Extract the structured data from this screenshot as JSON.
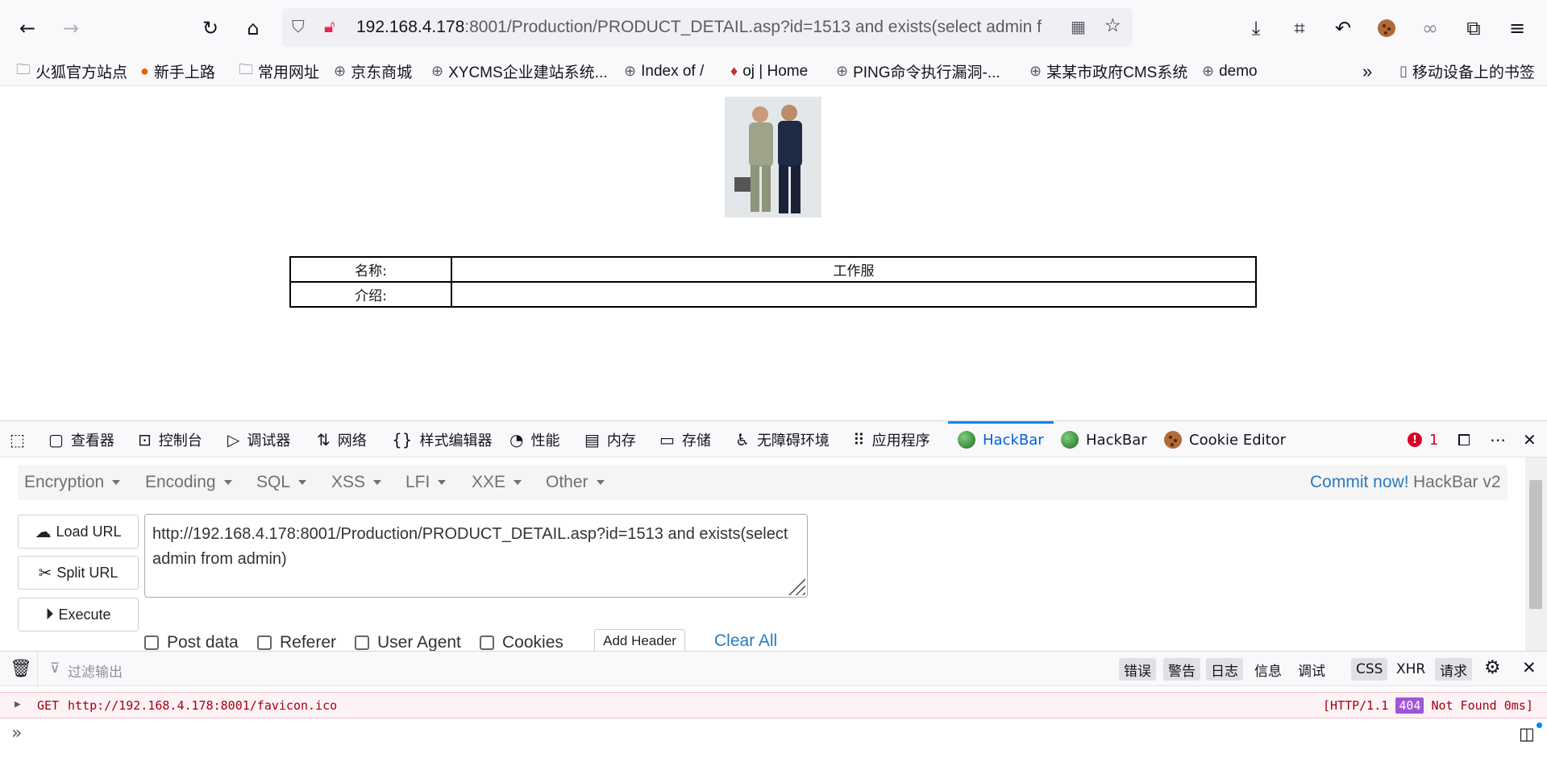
{
  "browser": {
    "url_host": "192.168.4.178",
    "url_rest": ":8001/Production/PRODUCT_DETAIL.asp?id=1513 and exists(select admin f",
    "bookmarks": [
      {
        "label": "火狐官方站点",
        "icon": "folder-icon"
      },
      {
        "label": "新手上路",
        "icon": "firefox-icon"
      },
      {
        "label": "常用网址",
        "icon": "folder-icon"
      },
      {
        "label": "京东商城",
        "icon": "globe-icon"
      },
      {
        "label": "XYCMS企业建站系统...",
        "icon": "globe-icon"
      },
      {
        "label": "Index of /",
        "icon": "globe-icon"
      },
      {
        "label": "oj | Home",
        "icon": "balloon-icon"
      },
      {
        "label": "PING命令执行漏洞-...",
        "icon": "globe-icon"
      },
      {
        "label": "某某市政府CMS系统",
        "icon": "globe-icon"
      },
      {
        "label": "demo",
        "icon": "globe-icon"
      }
    ],
    "mobile_bookmarks": "移动设备上的书签"
  },
  "page": {
    "rows": [
      {
        "label": "名称:",
        "value": "工作服"
      },
      {
        "label": "介绍:",
        "value": ""
      }
    ]
  },
  "devtools": {
    "tabs": [
      "查看器",
      "控制台",
      "调试器",
      "网络",
      "样式编辑器",
      "性能",
      "内存",
      "存储",
      "无障碍环境",
      "应用程序",
      "HackBar",
      "HackBar",
      "Cookie Editor"
    ],
    "error_count": "1"
  },
  "hackbar": {
    "menu": [
      "Encryption",
      "Encoding",
      "SQL",
      "XSS",
      "LFI",
      "XXE",
      "Other"
    ],
    "commit_link": "Commit now!",
    "version": "HackBar v2",
    "load_url": "Load URL",
    "split_url": "Split URL",
    "execute": "Execute",
    "url_value": "http://192.168.4.178:8001/Production/PRODUCT_DETAIL.asp?id=1513 and exists(select admin from admin)",
    "post_data": "Post data",
    "referer": "Referer",
    "user_agent": "User Agent",
    "cookies": "Cookies",
    "add_header": "Add Header",
    "clear_all": "Clear All"
  },
  "console": {
    "filter_placeholder": "过滤输出",
    "filters": [
      "错误",
      "警告",
      "日志",
      "信息",
      "调试"
    ],
    "type_filters": [
      "CSS",
      "XHR",
      "请求"
    ],
    "log_method": "GET",
    "log_url": "http://192.168.4.178:8001/favicon.ico",
    "log_protocol": "[HTTP/1.1",
    "log_status": "404",
    "log_status_text": "Not Found 0ms]"
  },
  "colors": {
    "accent": "#0061e0",
    "link": "#2a7ac0",
    "error_bg": "#fdf2f5",
    "status_badge": "#9f55d6"
  }
}
